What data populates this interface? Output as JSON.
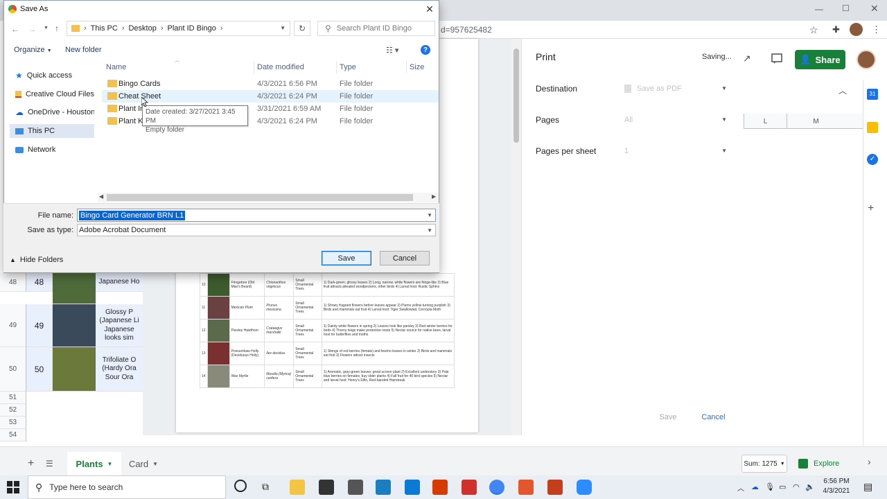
{
  "browser": {
    "url_fragment": "d=957625482"
  },
  "sheets": {
    "share_label": "Share",
    "column_headers": [
      "L",
      "M"
    ],
    "rows": [
      {
        "header": "48",
        "num": "48",
        "text": "Japanese Ho"
      },
      {
        "header": "49",
        "num": "49",
        "text": "Glossy P (Japanese Li Japanese looks sim"
      },
      {
        "header": "50",
        "num": "50",
        "text": "Trifoliate O (Hardy Ora Sour Ora"
      }
    ],
    "empty_rows": [
      "51",
      "52",
      "53",
      "54"
    ],
    "tabs": [
      {
        "label": "Plants"
      },
      {
        "label": "Card"
      }
    ],
    "sum_label": "Sum: 1275",
    "explore_label": "Explore"
  },
  "print": {
    "title": "Print",
    "status": "Saving...",
    "destination_label": "Destination",
    "destination_value": "Save as PDF",
    "pages_label": "Pages",
    "pages_value": "All",
    "pps_label": "Pages per sheet",
    "pps_value": "1",
    "save_label": "Save",
    "cancel_label": "Cancel"
  },
  "preview_rows": [
    {
      "num": "10",
      "name": "Fringetree (Old Man's Beard)",
      "latin": "Chionanthus virginicus",
      "cat": "Small Ornamental Trees",
      "desc": "1) Dark-green, glossy leaves 2) Long, narrow, white flowers are fringe-like 3) Blue fruit attracts pileated woodpeckers, other birds 4) Larval host: Rustic Sphinx"
    },
    {
      "num": "11",
      "name": "Mexican Plum",
      "latin": "Prunus mexicana",
      "cat": "Small Ornamental Trees",
      "desc": "1) Showy fragrant flowers before leaves appear 2) Plums yellow turning purplish 3) Birds and mammals eat fruit 4) Larval host: Tiger Swallowtail, Cecropia Moth"
    },
    {
      "num": "12",
      "name": "Parsley Hawthorn",
      "latin": "Crataegus marshallii",
      "cat": "Small Ornamental Trees",
      "desc": "1) Dainty white flowers in spring 2) Leaves look like parsley 3) Red winter berries for birds 4) Thorny twigs make protective nests 5) Nectar source for native bees, larval host for butterflies and moths"
    },
    {
      "num": "13",
      "name": "Possumhaw Holly (Deciduous Holly)",
      "latin": "Ilex decidua",
      "cat": "Small Ornamental Trees",
      "desc": "1) Strings of red berries (female) and few/no leaves in winter 2) Birds and mammals eat fruit 3) Flowers attract insects"
    },
    {
      "num": "14",
      "name": "Wax Myrtle",
      "latin": "Morella (Myrica) cerifera",
      "cat": "Small Ornamental Trees",
      "desc": "1) Aromatic, gray-green leaves; great screen plant 2) Excellent understory 3) Pale blue berries on females; buy older plants 4) Fall fruit for 40 bird species 5) Nectar and larval host: Henry's Elfin, Red-banded Hairstreak"
    }
  ],
  "dialog": {
    "title": "Save As",
    "breadcrumb": [
      "This PC",
      "Desktop",
      "Plant ID Bingo"
    ],
    "search_placeholder": "Search Plant ID Bingo",
    "organize_label": "Organize",
    "new_folder_label": "New folder",
    "nav": [
      "Quick access",
      "Creative Cloud Files",
      "OneDrive - Houston C",
      "This PC",
      "Network"
    ],
    "columns": [
      "Name",
      "Date modified",
      "Type",
      "Size"
    ],
    "files": [
      {
        "name": "Bingo Cards",
        "date": "4/3/2021 6:56 PM",
        "type": "File folder"
      },
      {
        "name": "Cheat Sheet",
        "date": "4/3/2021 6:24 PM",
        "type": "File folder"
      },
      {
        "name": "Plant Im",
        "date": "3/31/2021 6:59 AM",
        "type": "File folder"
      },
      {
        "name": "Plant Kn",
        "date": "4/3/2021 6:24 PM",
        "type": "File folder"
      }
    ],
    "tooltip_line1": "Date created: 3/27/2021 3:45 PM",
    "tooltip_line2": "Empty folder",
    "filename_label": "File name:",
    "filename_value": "Bingo Card Generator BRN L1",
    "savetype_label": "Save as type:",
    "savetype_value": "Adobe Acrobat Document",
    "save_label": "Save",
    "cancel_label": "Cancel",
    "hide_folders_label": "Hide Folders"
  },
  "taskbar": {
    "search_placeholder": "Type here to search",
    "time": "6:56 PM",
    "date": "4/3/2021"
  }
}
